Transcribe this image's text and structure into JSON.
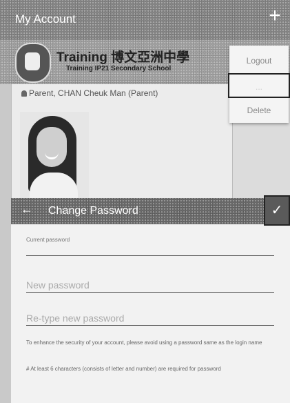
{
  "topbar": {
    "title": "My Account",
    "add_icon": "plus-icon"
  },
  "banner": {
    "school_name_cn": "Training 博文亞洲中學",
    "school_name_en": "Training IP21 Secondary School",
    "crest_icon": "school-crest-icon"
  },
  "profile": {
    "user_line": "Parent, CHAN Cheuk Man (Parent)",
    "user_icon": "person-icon"
  },
  "menu": {
    "items": [
      {
        "label": "Logout"
      },
      {
        "label": "..."
      },
      {
        "label": "Delete"
      }
    ]
  },
  "change_password": {
    "title": "Change Password",
    "current_password_label": "Current password",
    "new_password_placeholder": "New password",
    "retype_password_placeholder": "Re-type new password",
    "note_security": "To enhance the security of your account, please avoid using a password same as the login name",
    "note_requirement": "# At least 6 characters (consists of letter and number) are required for password"
  },
  "colors": {
    "toolbar": "#8a8a8a",
    "dialog_header": "#6e6e6e"
  }
}
